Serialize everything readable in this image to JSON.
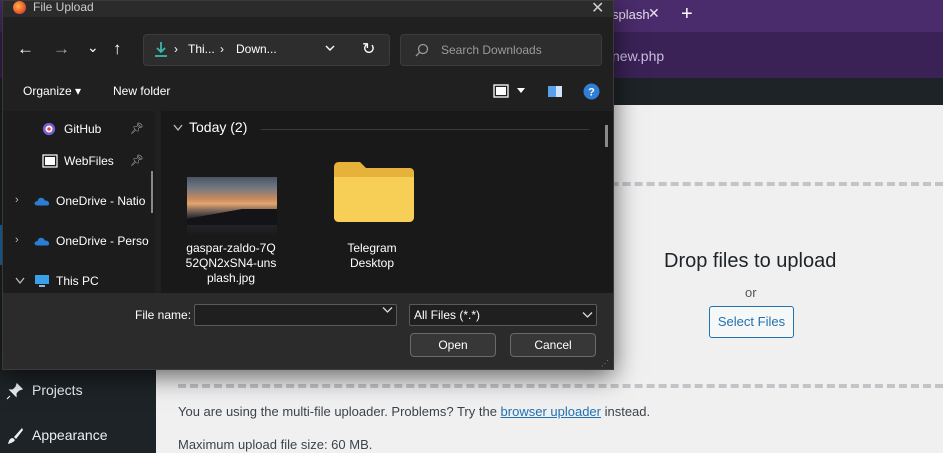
{
  "browser": {
    "tab_title": "splash",
    "tab_close": "✕",
    "new_tab": "+",
    "url_fragment": "new.php"
  },
  "wp_sidebar": {
    "items": [
      {
        "label": "Projects",
        "icon": "pin-icon"
      },
      {
        "label": "Appearance",
        "icon": "paintbrush-icon"
      }
    ]
  },
  "upload_area": {
    "title": "Drop files to upload",
    "or": "or",
    "select_button": "Select Files",
    "note_prefix": "You are using the multi-file uploader. Problems? Try the ",
    "note_link": "browser uploader",
    "note_suffix": " instead.",
    "max_size": "Maximum upload file size: 60 MB."
  },
  "dialog": {
    "title": "File Upload",
    "close": "✕",
    "nav": {
      "back": "←",
      "forward": "→",
      "recent": "⌄",
      "up": "↑"
    },
    "address": {
      "crumbs": [
        "Thi...",
        "Down..."
      ],
      "separator": "›",
      "refresh": "↻"
    },
    "search_placeholder": "Search Downloads",
    "toolbar": {
      "organize": "Organize ▾",
      "new_folder": "New folder"
    },
    "sidebar": [
      {
        "label": "GitHub",
        "pinned": true,
        "icon": "github-desktop-icon"
      },
      {
        "label": "WebFiles",
        "pinned": true,
        "icon": "folder-shortcut-icon"
      },
      {
        "label": "OneDrive - Natio",
        "expandable": true,
        "icon": "onedrive-icon"
      },
      {
        "label": "OneDrive - Perso",
        "expandable": true,
        "icon": "onedrive-icon"
      },
      {
        "label": "This PC",
        "expanded": true,
        "icon": "computer-icon"
      }
    ],
    "group_header": "Today (2)",
    "files": [
      {
        "name": "gaspar-zaldo-7Q52QN2xSN4-unsplash.jpg",
        "lines": [
          "gaspar-zaldo-7Q",
          "52QN2xSN4-uns",
          "plash.jpg"
        ],
        "type": "image"
      },
      {
        "name": "Telegram Desktop",
        "lines": [
          "Telegram",
          "Desktop"
        ],
        "type": "folder"
      }
    ],
    "file_name_label": "File name:",
    "file_name_value": "",
    "file_type": "All Files (*.*)",
    "open_button": "Open",
    "cancel_button": "Cancel",
    "colors": {
      "accent": "#2271b1",
      "dialog_bg": "#202020",
      "browser_bar": "#4a2b6b"
    }
  }
}
